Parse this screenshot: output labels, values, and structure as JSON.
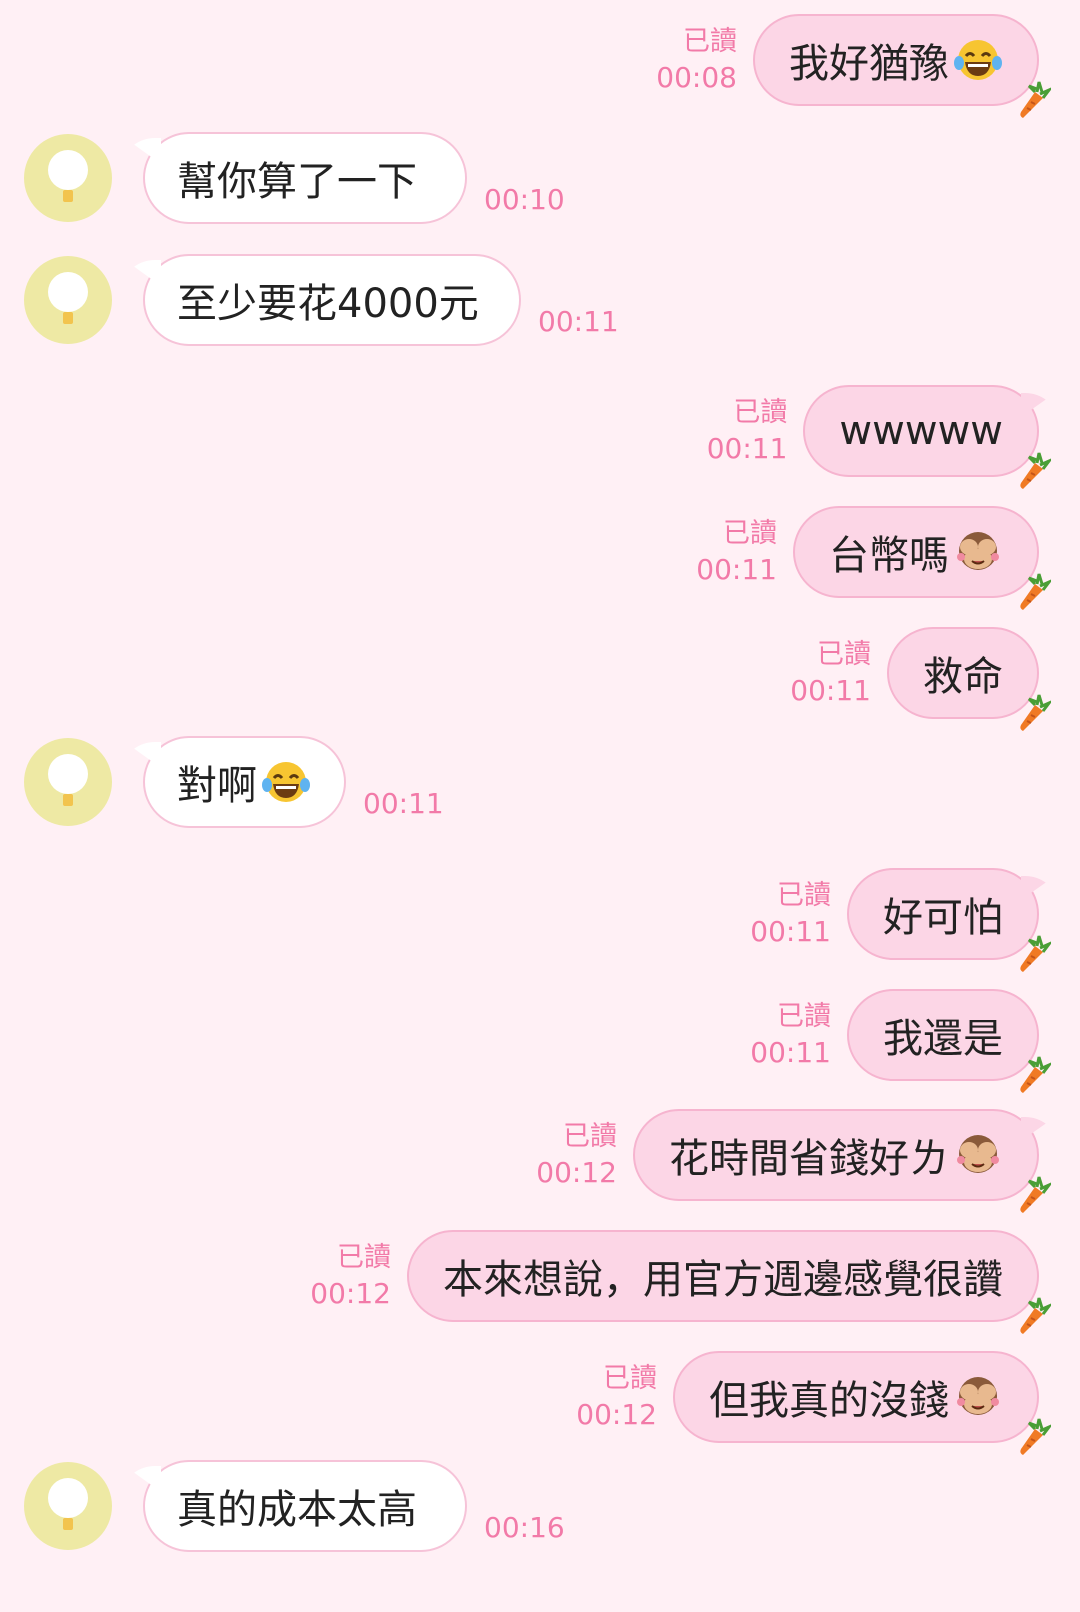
{
  "colors": {
    "background": "#fff0f5",
    "sent_bubble": "#fcd6e6",
    "received_bubble": "#ffffff",
    "meta_text": "#f27aa8",
    "avatar": "#eee9a4"
  },
  "messages": [
    {
      "side": "sent",
      "text": "我好猶豫",
      "emoji": "laugh-cry-emoji",
      "read": "已讀",
      "time": "00:08"
    },
    {
      "side": "received",
      "text": "幫你算了一下",
      "time": "00:10"
    },
    {
      "side": "received",
      "text": "至少要花4000元",
      "time": "00:11"
    },
    {
      "side": "sent",
      "text": "wwwww",
      "read": "已讀",
      "time": "00:11"
    },
    {
      "side": "sent",
      "text": "台幣嗎",
      "emoji": "see-no-evil-monkey-emoji",
      "read": "已讀",
      "time": "00:11"
    },
    {
      "side": "sent",
      "text": "救命",
      "read": "已讀",
      "time": "00:11"
    },
    {
      "side": "received",
      "text": "對啊",
      "emoji": "laugh-cry-emoji",
      "time": "00:11"
    },
    {
      "side": "sent",
      "text": "好可怕",
      "read": "已讀",
      "time": "00:11"
    },
    {
      "side": "sent",
      "text": "我還是",
      "read": "已讀",
      "time": "00:11"
    },
    {
      "side": "sent",
      "text": "花時間省錢好ㄌ",
      "emoji": "see-no-evil-monkey-emoji",
      "read": "已讀",
      "time": "00:12"
    },
    {
      "side": "sent",
      "text": "本來想說，用官方週邊感覺很讚",
      "read": "已讀",
      "time": "00:12"
    },
    {
      "side": "sent",
      "text": "但我真的沒錢",
      "emoji": "see-no-evil-monkey-emoji",
      "read": "已讀",
      "time": "00:12"
    },
    {
      "side": "received",
      "text": "真的成本太高",
      "time": "00:16"
    }
  ]
}
